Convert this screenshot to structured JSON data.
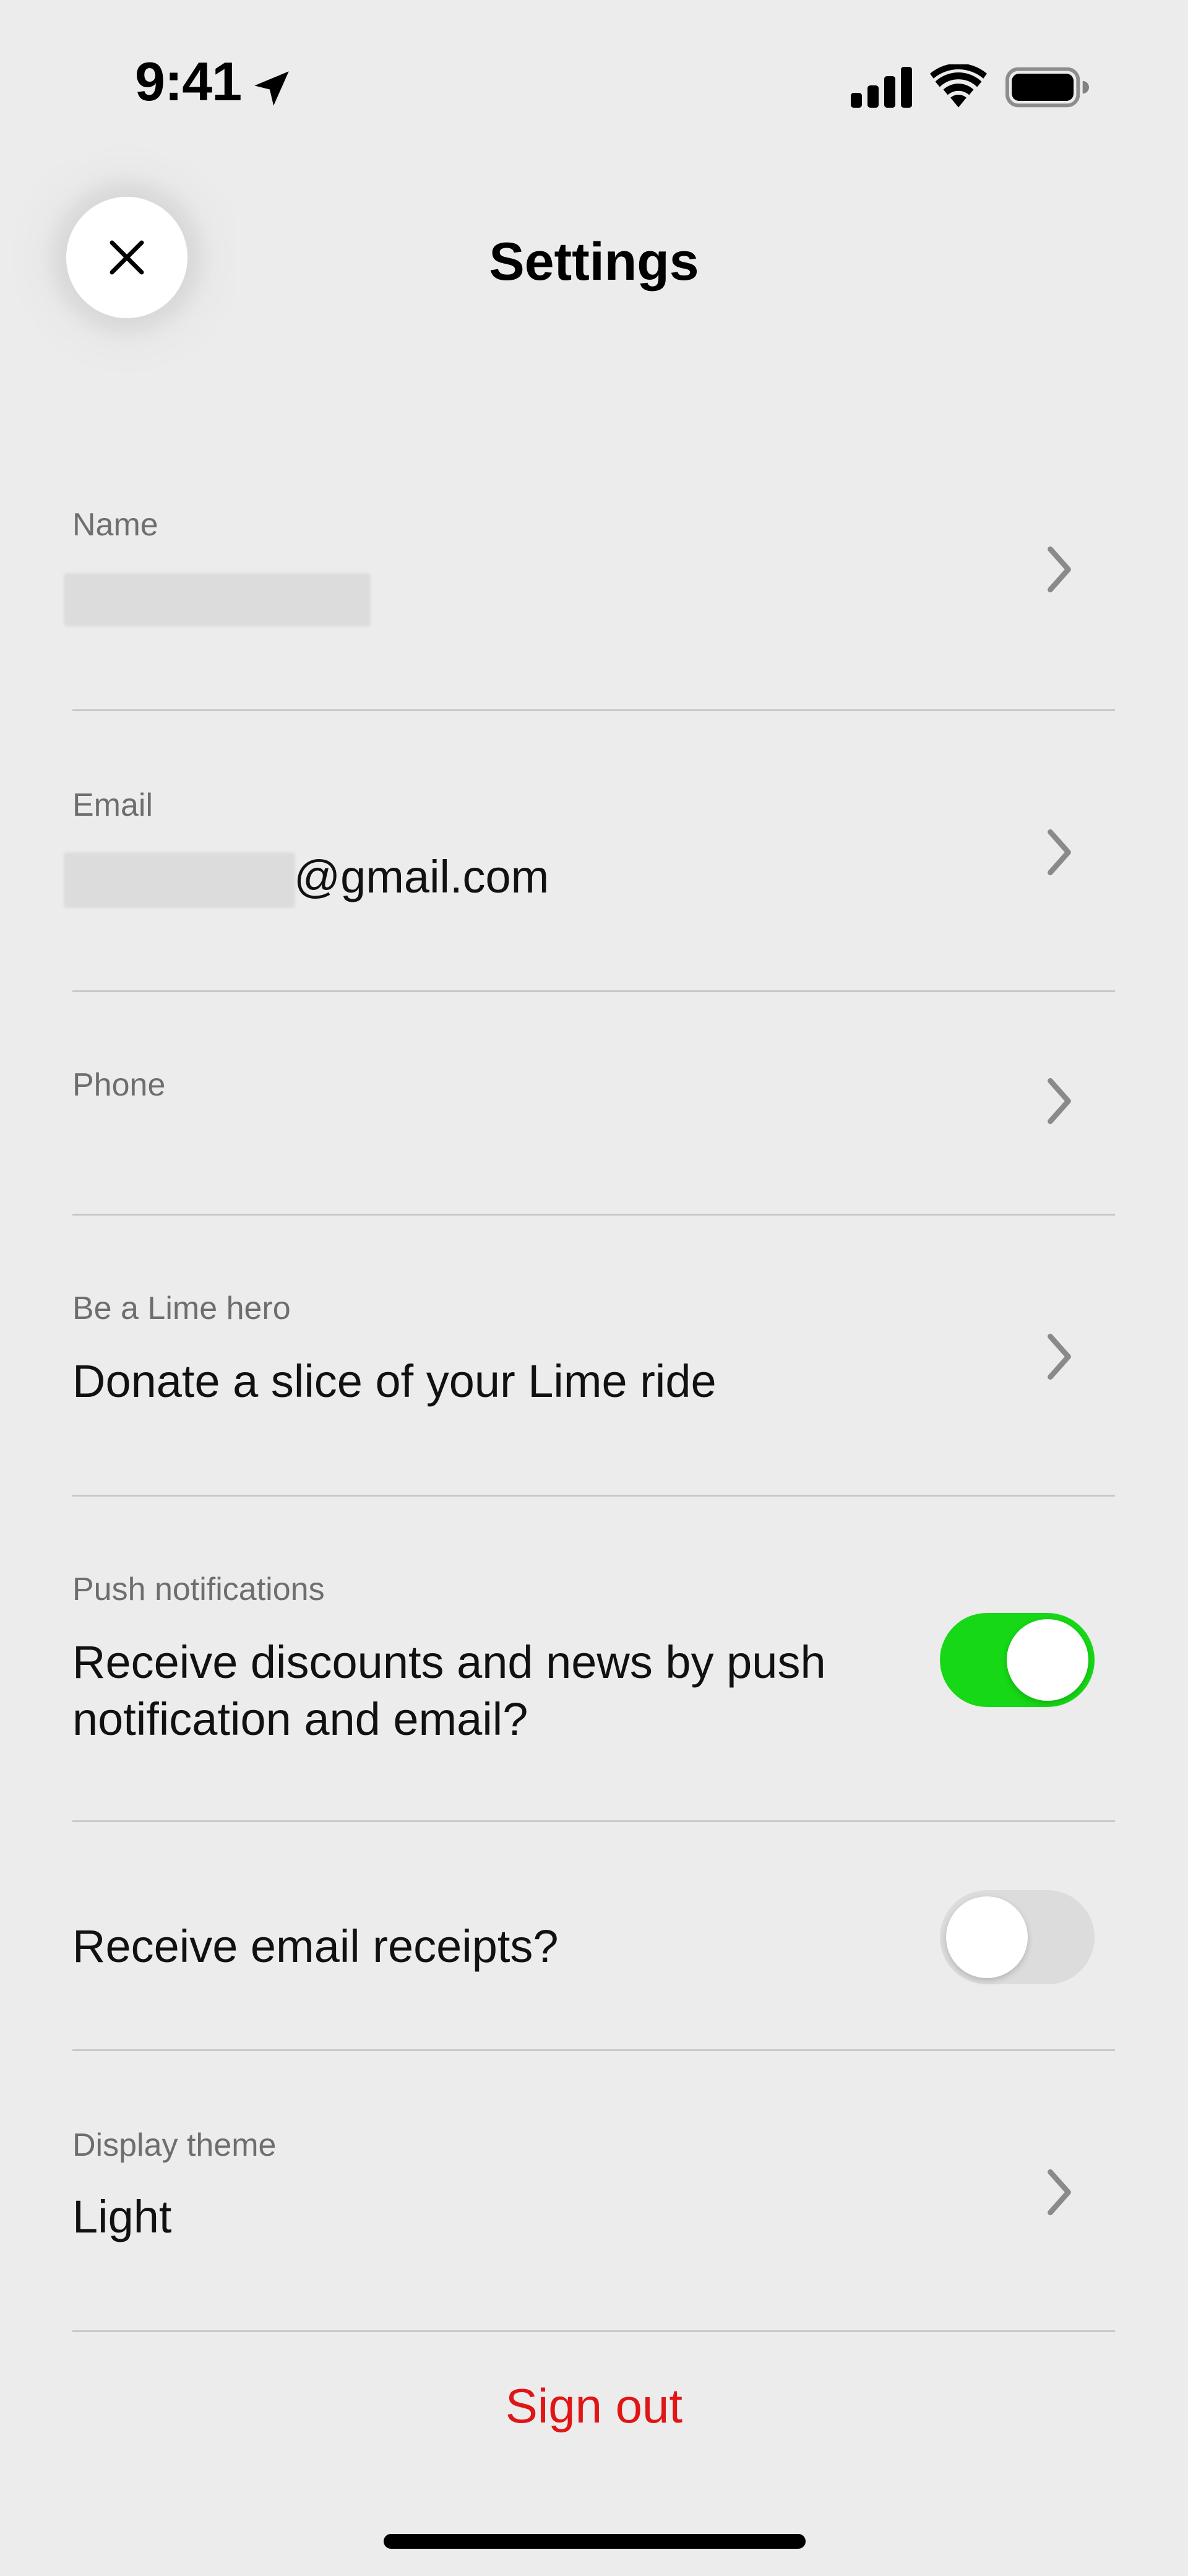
{
  "status_bar": {
    "time": "9:41",
    "icons": [
      "location-arrow-icon",
      "cellular-signal-icon",
      "wifi-icon",
      "battery-icon"
    ]
  },
  "header": {
    "title": "Settings",
    "close_icon": "close-icon"
  },
  "rows": {
    "name": {
      "label": "Name",
      "value": ""
    },
    "email": {
      "label": "Email",
      "value_suffix": "@gmail.com"
    },
    "phone": {
      "label": "Phone",
      "value": ""
    },
    "lime_hero": {
      "label": "Be a Lime hero",
      "value": "Donate a slice of your Lime ride"
    },
    "push": {
      "label": "Push notifications",
      "value_line1": "Receive discounts and news by push",
      "value_line2": "notification and email?",
      "toggle_on": true
    },
    "receipts": {
      "value": "Receive email receipts?",
      "toggle_on": false
    },
    "theme": {
      "label": "Display theme",
      "value": "Light"
    }
  },
  "sign_out": {
    "label": "Sign out"
  },
  "colors": {
    "background": "#ececec",
    "toggle_on": "#16d816",
    "toggle_off": "#dcdcdc",
    "sign_out": "#e01515",
    "divider": "#c8c8c8"
  }
}
